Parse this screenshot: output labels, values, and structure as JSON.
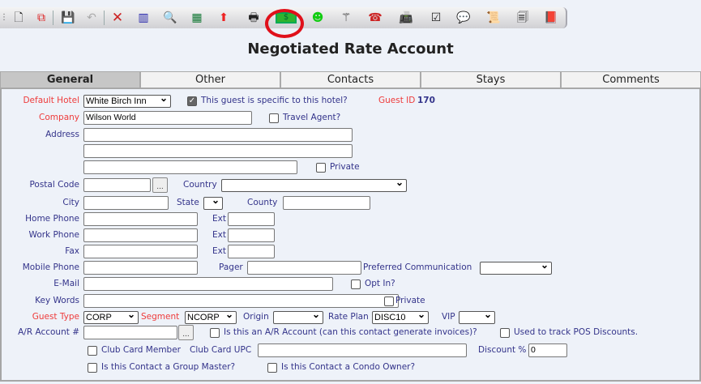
{
  "toolbar": {
    "icons": [
      "new-icon",
      "copy-icon",
      "save-icon",
      "undo-icon",
      "delete-icon",
      "merge-icon",
      "search-add-icon",
      "network-icon",
      "export-icon",
      "print-icon",
      "negotiated-rate-icon",
      "smiley-icon",
      "wand-icon",
      "phone-icon",
      "fax-icon",
      "clipboard-icon",
      "comment-icon",
      "scroll-icon",
      "documents-icon",
      "book-icon"
    ],
    "highlight_color": "#e0101a"
  },
  "title": "Negotiated Rate Account",
  "tabs": [
    "General",
    "Other",
    "Contacts",
    "Stays",
    "Comments"
  ],
  "form": {
    "default_hotel_label": "Default Hotel",
    "default_hotel": "White Birch Inn",
    "specific_label": "This guest is specific to this hotel?",
    "guest_id_label": "Guest ID",
    "guest_id": "170",
    "company_label": "Company",
    "company": "Wilson World",
    "travel_agent_label": "Travel Agent?",
    "address_label": "Address",
    "private_label": "Private",
    "postal_label": "Postal Code",
    "ellipsis": "...",
    "country_label": "Country",
    "city_label": "City",
    "state_label": "State",
    "county_label": "County",
    "home_phone_label": "Home Phone",
    "work_phone_label": "Work Phone",
    "fax_label": "Fax",
    "ext_label": "Ext",
    "mobile_label": "Mobile Phone",
    "pager_label": "Pager",
    "pref_comm_label": "Preferred Communication",
    "email_label": "E-Mail",
    "opt_in_label": "Opt In?",
    "keywords_label": "Key Words",
    "guest_type_label": "Guest Type",
    "guest_type": "CORP",
    "segment_label": "Segment",
    "segment": "NCORP",
    "origin_label": "Origin",
    "rate_plan_label": "Rate Plan",
    "rate_plan": "DISC10",
    "vip_label": "VIP",
    "ar_label": "A/R Account #",
    "ar_question": "Is this an A/R Account (can this contact generate invoices)?",
    "pos_label": "Used to track POS Discounts.",
    "club_member_label": "Club Card Member",
    "club_upc_label": "Club Card UPC",
    "discount_label": "Discount %",
    "discount": "0",
    "group_master_label": "Is this Contact a Group Master?",
    "condo_label": "Is this Contact a Condo Owner?"
  }
}
